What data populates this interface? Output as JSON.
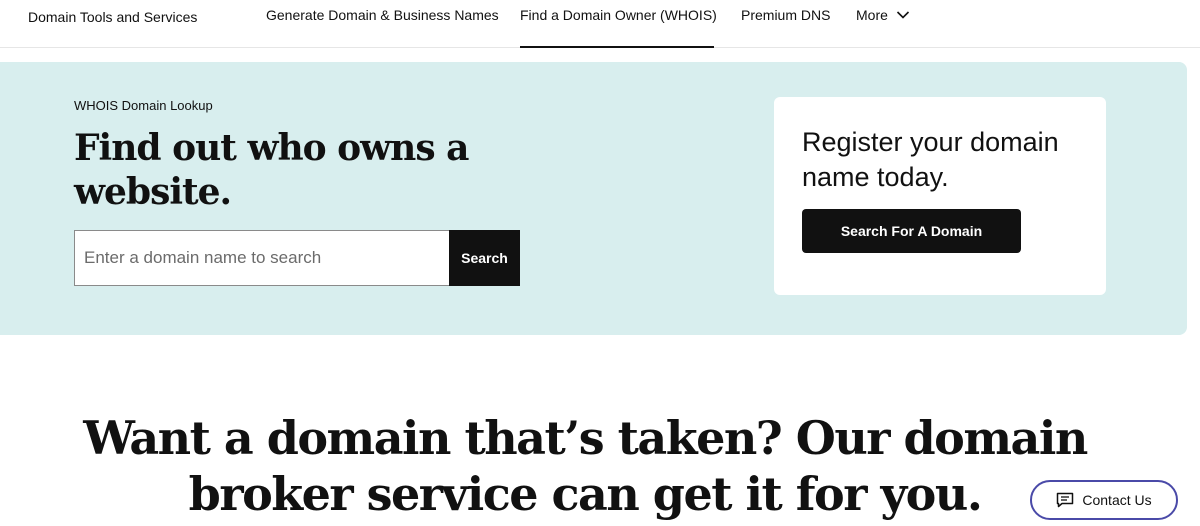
{
  "nav": {
    "brand": "Domain Tools and Services",
    "items": [
      {
        "label": "Generate Domain & Business Names"
      },
      {
        "label": "Find a Domain Owner (WHOIS)"
      },
      {
        "label": "Premium DNS"
      },
      {
        "label": "More"
      }
    ],
    "more_icon": "chevron-down-icon"
  },
  "hero": {
    "eyebrow": "WHOIS Domain Lookup",
    "title": "Find out who owns a website.",
    "search": {
      "placeholder": "Enter a domain name to search",
      "value": "",
      "button_label": "Search"
    },
    "background": "#d8eeee"
  },
  "card": {
    "title": "Register your domain name today.",
    "button_label": "Search For A Domain"
  },
  "broker": {
    "title": "Want a domain that’s taken? Our domain broker service can get it for you."
  },
  "contact": {
    "label": "Contact Us",
    "icon": "chat-icon",
    "border_color": "#4a4aa8"
  }
}
